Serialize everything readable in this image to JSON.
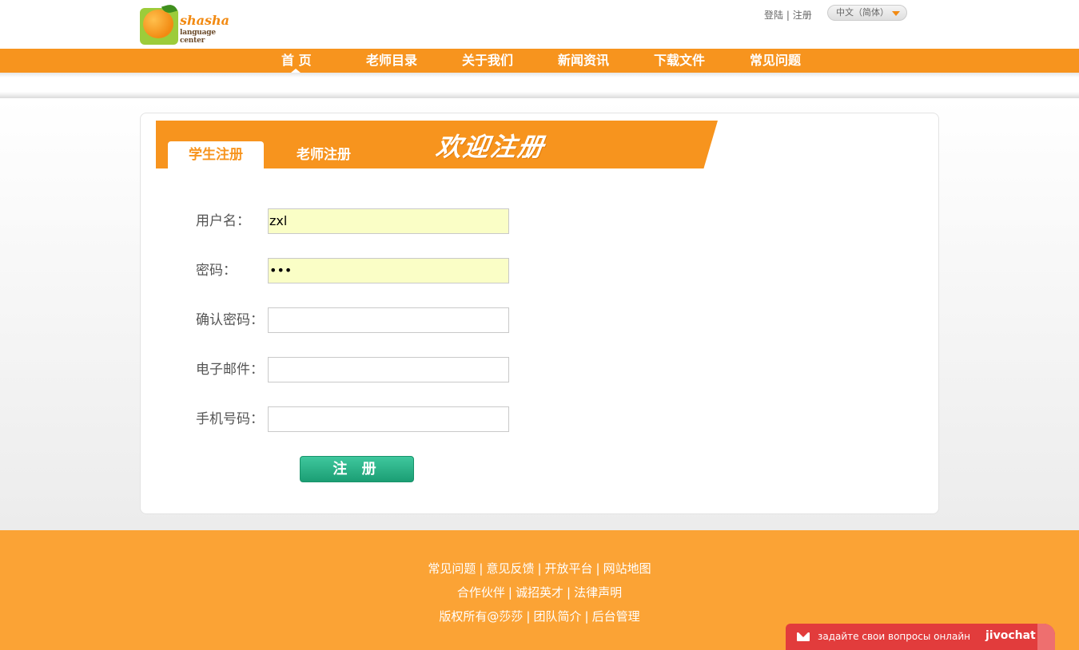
{
  "header": {
    "logo_text_main": "shasha",
    "logo_text_sub": "language center",
    "login_link": "登陆",
    "link_separator": " | ",
    "register_link": "注册",
    "language": "中文（简体）"
  },
  "nav": {
    "items": [
      {
        "label": "首 页"
      },
      {
        "label": "老师目录"
      },
      {
        "label": "关于我们"
      },
      {
        "label": "新闻资讯"
      },
      {
        "label": "下载文件"
      },
      {
        "label": "常见问题"
      }
    ]
  },
  "register": {
    "tabs": [
      "学生注册",
      "老师注册"
    ],
    "welcome": "欢迎注册",
    "fields": [
      {
        "label": "用户名：",
        "value": "zxl"
      },
      {
        "label": "密码：",
        "value": "•••"
      },
      {
        "label": "确认密码：",
        "value": ""
      },
      {
        "label": "电子邮件：",
        "value": ""
      },
      {
        "label": "手机号码：",
        "value": ""
      }
    ],
    "submit_label": "注 册"
  },
  "footer": {
    "row1": [
      "常见问题",
      "意见反馈",
      "开放平台",
      "网站地图"
    ],
    "row2": [
      "合作伙伴",
      "诚招英才",
      "法律声明"
    ],
    "row3": [
      "版权所有@莎莎",
      "团队简介",
      "后台管理"
    ]
  },
  "chat": {
    "text": "задайте свои вопросы онлайн",
    "brand": "jivochat"
  },
  "colors": {
    "accent": "#f7941e",
    "footer": "#fba335",
    "button": "#23a97f",
    "chat": "#e23c3c"
  }
}
